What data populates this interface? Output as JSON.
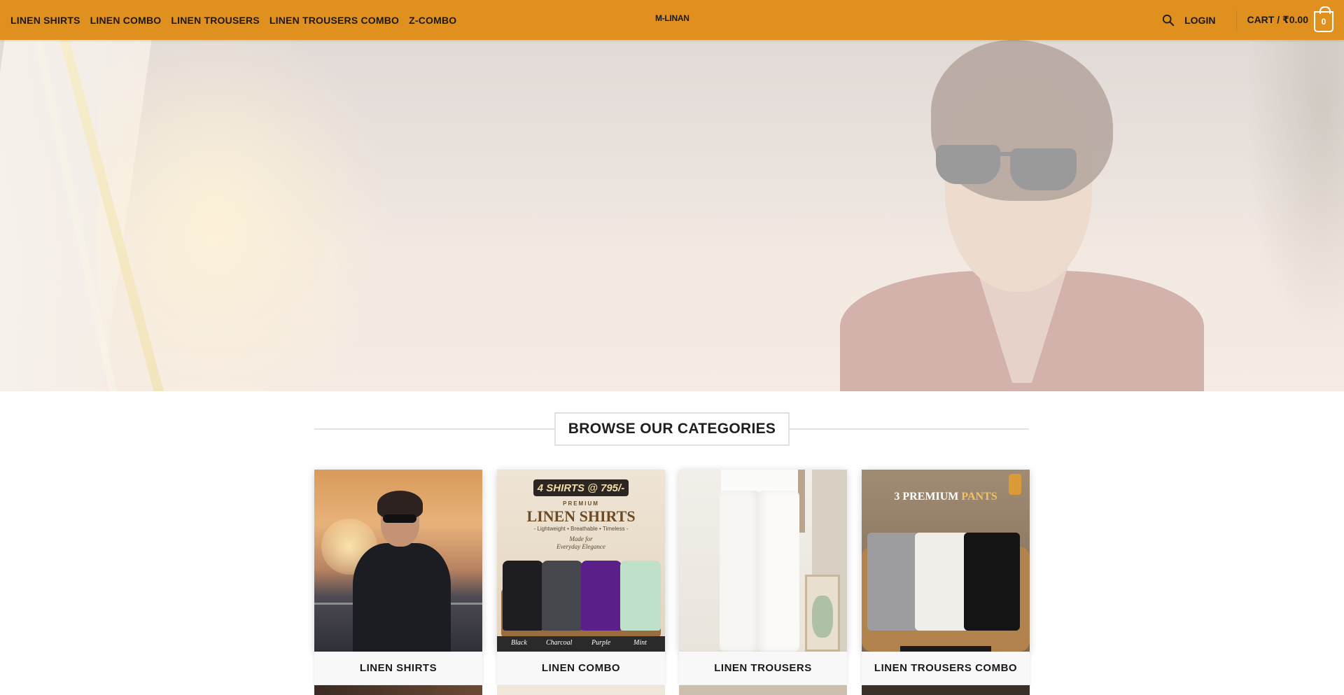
{
  "header": {
    "nav": [
      "LINEN SHIRTS",
      "LINEN COMBO",
      "LINEN TROUSERS",
      "LINEN TROUSERS COMBO",
      "Z-COMBO"
    ],
    "logo": "M-LINAN",
    "login": "LOGIN",
    "cart": "CART / ₹0.00",
    "cart_count": "0",
    "accent_color": "#e0901e"
  },
  "hero": {
    "image": "man-with-sunglasses-on-yacht-sunset"
  },
  "section": {
    "title": "BROWSE OUR CATEGORIES"
  },
  "categories": [
    {
      "label": "LINEN SHIRTS",
      "image": "man-black-linen-shirt-yacht"
    },
    {
      "label": "LINEN COMBO",
      "image": "four-linen-shirts-promo",
      "promo": {
        "badge": "4 SHIRTS @ 795/-",
        "premium": "PREMIUM",
        "headline": "LINEN SHIRTS",
        "sub": "- Lightweight • Breathable • Timeless -",
        "made1": "Made for",
        "made2": "Everyday Elegance",
        "colors": [
          "Black",
          "Charcoal",
          "Purple",
          "Mint"
        ]
      }
    },
    {
      "label": "LINEN TROUSERS",
      "image": "white-linen-trousers"
    },
    {
      "label": "LINEN TROUSERS COMBO",
      "image": "three-premium-pants-tray",
      "promo": {
        "title_a": "3 PREMIUM",
        "title_b": "PANTS"
      }
    }
  ]
}
